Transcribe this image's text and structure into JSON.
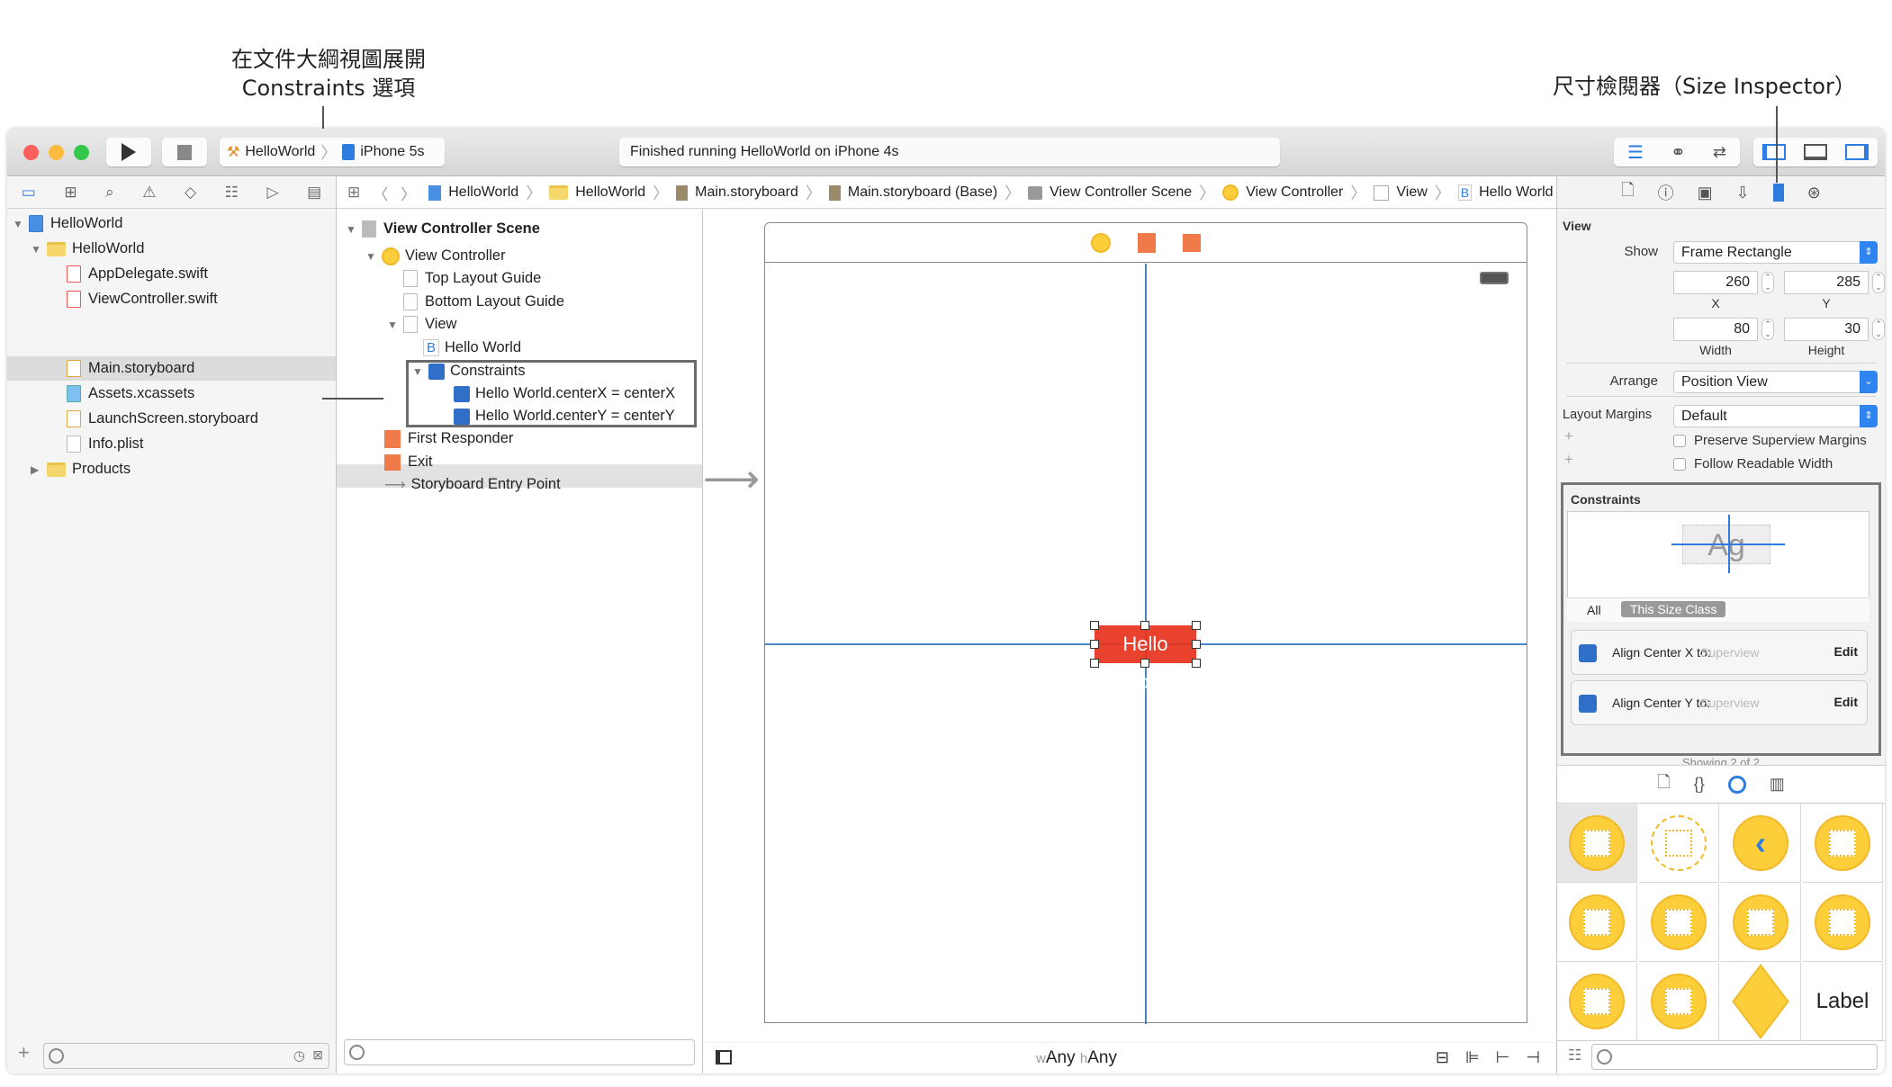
{
  "annotations": {
    "left_line1": "在文件大綱視圖展開",
    "left_line2": "Constraints 選項",
    "right": "尺寸檢閱器（Size Inspector）"
  },
  "toolbar": {
    "scheme": "HelloWorld",
    "device": "iPhone 5s",
    "status": "Finished running HelloWorld on iPhone 4s"
  },
  "navigator": {
    "items": [
      {
        "label": "HelloWorld",
        "type": "project"
      },
      {
        "label": "HelloWorld",
        "type": "folder"
      },
      {
        "label": "AppDelegate.swift",
        "type": "swift"
      },
      {
        "label": "ViewController.swift",
        "type": "swift"
      },
      {
        "label": "Main.storyboard",
        "type": "storyboard",
        "selected": true
      },
      {
        "label": "Assets.xcassets",
        "type": "assets"
      },
      {
        "label": "LaunchScreen.storyboard",
        "type": "storyboard"
      },
      {
        "label": "Info.plist",
        "type": "plist"
      },
      {
        "label": "Products",
        "type": "folder"
      }
    ]
  },
  "breadcrumb": [
    "HelloWorld",
    "HelloWorld",
    "Main.storyboard",
    "Main.storyboard (Base)",
    "View Controller Scene",
    "View Controller",
    "View",
    "Hello World"
  ],
  "outline": {
    "items": [
      "View Controller Scene",
      "View Controller",
      "Top Layout Guide",
      "Bottom Layout Guide",
      "View",
      "Hello World",
      "Constraints",
      "Hello World.centerX = centerX",
      "Hello World.centerY = centerY",
      "First Responder",
      "Exit",
      "Storyboard Entry Point"
    ]
  },
  "canvas": {
    "button_label": "Hello World",
    "button_color": "#e8321e",
    "size_class_w_prefix": "w",
    "size_class_w": "Any",
    "size_class_h_prefix": "h",
    "size_class_h": "Any"
  },
  "inspector": {
    "section": "View",
    "show_label": "Show",
    "show_value": "Frame Rectangle",
    "x": "260",
    "x_label": "X",
    "y": "285",
    "y_label": "Y",
    "width": "80",
    "width_label": "Width",
    "height": "30",
    "height_label": "Height",
    "arrange_label": "Arrange",
    "arrange_value": "Position View",
    "margins_label": "Layout Margins",
    "margins_value": "Default",
    "preserve_margins": "Preserve Superview Margins",
    "follow_readable": "Follow Readable Width",
    "constraints_title": "Constraints",
    "preview_text": "Ag",
    "tab_all": "All",
    "tab_size_class": "This Size Class",
    "constraints": [
      {
        "label": "Align Center X to:",
        "target": "Superview",
        "action": "Edit"
      },
      {
        "label": "Align Center Y to:",
        "target": "Superview",
        "action": "Edit"
      }
    ],
    "showing": "Showing 2 of 2"
  },
  "library": {
    "label_item": "Label",
    "accent": "#fcce3a"
  }
}
